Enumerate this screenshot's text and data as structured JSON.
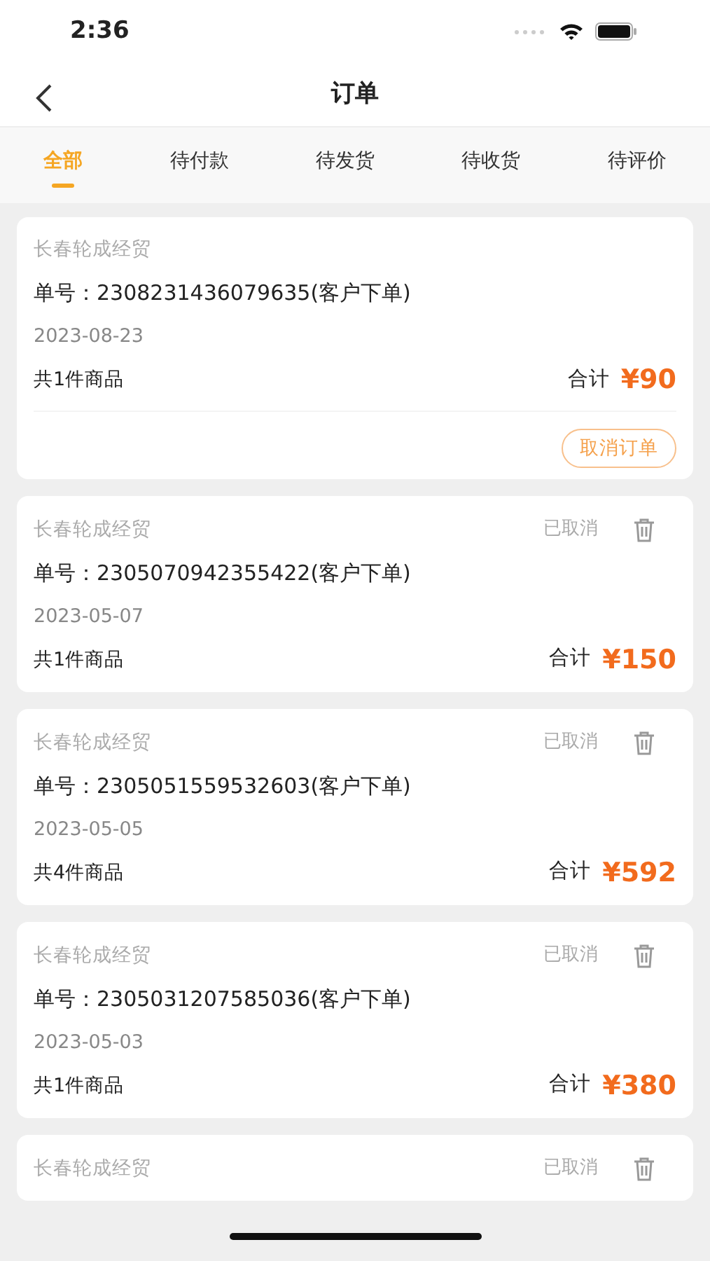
{
  "status_bar": {
    "time": "2:36"
  },
  "header": {
    "title": "订单"
  },
  "tabs": [
    {
      "label": "全部",
      "selected": true
    },
    {
      "label": "待付款",
      "selected": false
    },
    {
      "label": "待发货",
      "selected": false
    },
    {
      "label": "待收货",
      "selected": false
    },
    {
      "label": "待评价",
      "selected": false
    }
  ],
  "orders": [
    {
      "shop": "长春轮成经贸",
      "order_no": "单号：2308231436079635(客户下单)",
      "date": "2023-08-23",
      "items": "共1件商品",
      "total_label": "合计",
      "total": "¥90",
      "action": "取消订单"
    },
    {
      "shop": "长春轮成经贸",
      "status": "已取消",
      "order_no": "单号：2305070942355422(客户下单)",
      "date": "2023-05-07",
      "items": "共1件商品",
      "total_label": "合计",
      "total": "¥150"
    },
    {
      "shop": "长春轮成经贸",
      "status": "已取消",
      "order_no": "单号：2305051559532603(客户下单)",
      "date": "2023-05-05",
      "items": "共4件商品",
      "total_label": "合计",
      "total": "¥592"
    },
    {
      "shop": "长春轮成经贸",
      "status": "已取消",
      "order_no": "单号：2305031207585036(客户下单)",
      "date": "2023-05-03",
      "items": "共1件商品",
      "total_label": "合计",
      "total": "¥380"
    },
    {
      "shop": "长春轮成经贸",
      "status": "已取消"
    }
  ]
}
